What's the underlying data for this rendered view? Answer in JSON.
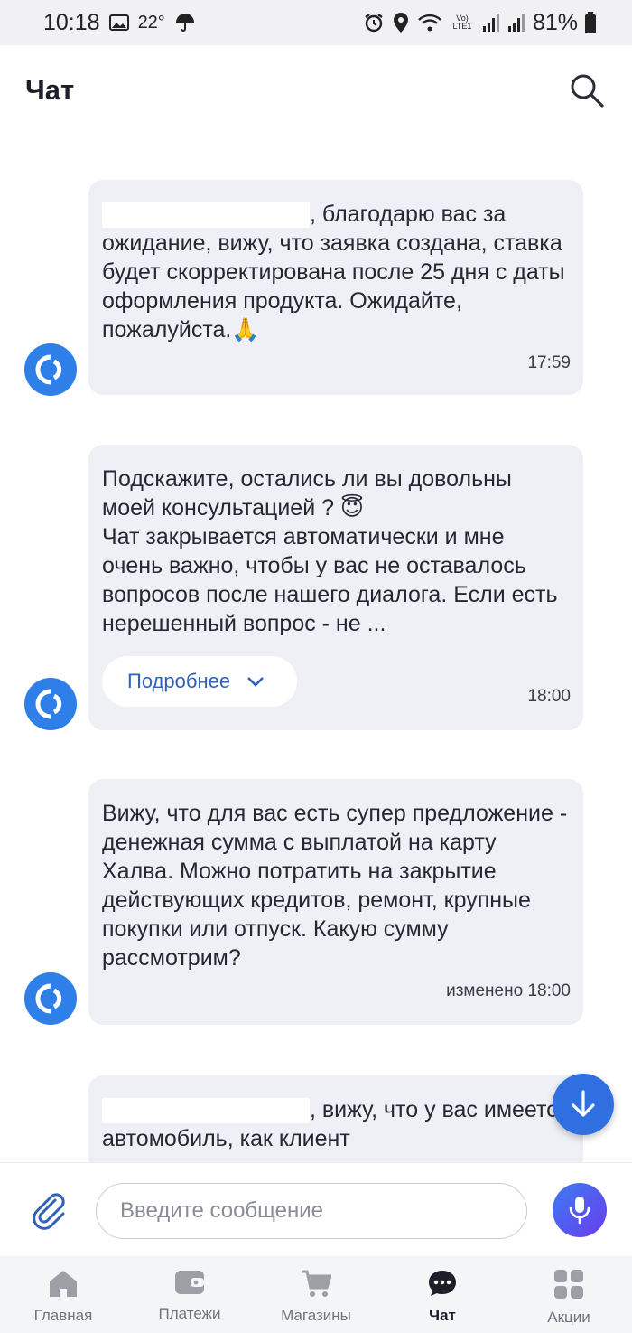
{
  "status_bar": {
    "time": "10:18",
    "temperature": "22°",
    "battery": "81%",
    "network": "Vo) LTE1"
  },
  "header": {
    "title": "Чат"
  },
  "messages": [
    {
      "text": ", благодарю вас за ожидание, вижу, что заявка создана, ставка будет скорректирована после 25 дня с даты оформления продукта. Ожидайте, пожалуйста.🙏",
      "time": "17:59"
    },
    {
      "text": "Подскажите, остались ли вы довольны моей консультацией ? 😇\nЧат закрывается автоматически и мне очень важно, чтобы у вас не оставалось вопросов после нашего диалога. Если есть нерешенный вопрос - не ...",
      "more_label": "Подробнее",
      "time": "18:00"
    },
    {
      "text": "Вижу, что для вас есть супер предложение - денежная сумма с выплатой на карту Халва. Можно потратить на закрытие действующих кредитов, ремонт, крупные покупки или отпуск. Какую сумму рассмотрим?",
      "time": "изменено 18:00"
    },
    {
      "text": ", вижу, что у вас имеется автомобиль, как клиент"
    }
  ],
  "composer": {
    "placeholder": "Введите сообщение"
  },
  "nav": [
    {
      "label": "Главная",
      "icon": "home-icon"
    },
    {
      "label": "Платежи",
      "icon": "wallet-icon"
    },
    {
      "label": "Магазины",
      "icon": "cart-icon"
    },
    {
      "label": "Чат",
      "icon": "chat-icon",
      "active": true
    },
    {
      "label": "Акции",
      "icon": "grid-icon"
    }
  ],
  "colors": {
    "accent": "#2f7fe8",
    "bubble": "#eff0f5",
    "link": "#2e63b8"
  }
}
